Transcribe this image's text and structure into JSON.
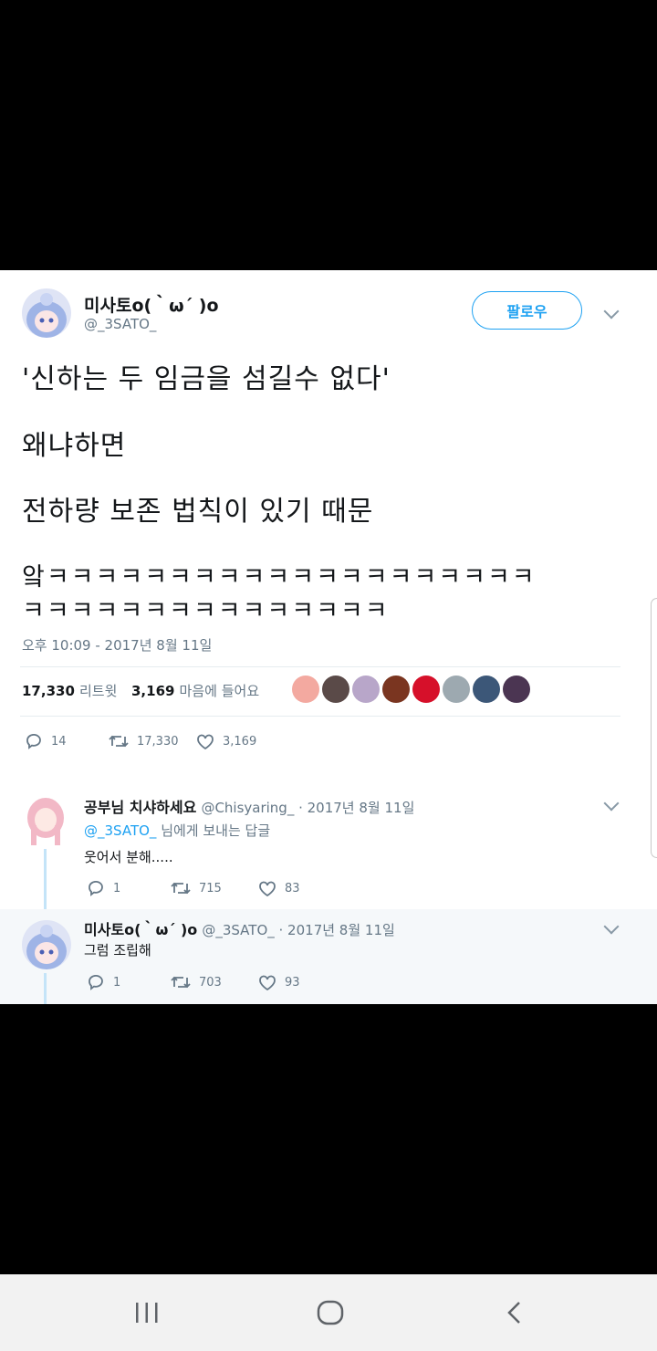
{
  "tweet": {
    "author_name": "미사토o(｀ω´ )o",
    "author_handle": "@_3SATO_",
    "follow_label": "팔로우",
    "lines": [
      "'신하는 두 임금을 섬길수 없다'",
      "왜냐하면",
      "전하량 보존 법칙이 있기 때문",
      "앜ㅋㅋㅋㅋㅋㅋㅋㅋㅋㅋㅋㅋㅋㅋㅋㅋㅋㅋㅋㅋ",
      "ㅋㅋㅋㅋㅋㅋㅋㅋㅋㅋㅋㅋㅋㅋㅋ"
    ],
    "timestamp": "오후 10:09 - 2017년 8월 11일",
    "retweet_count": "17,330",
    "retweet_label": "리트윗",
    "like_count": "3,169",
    "like_label": "마음에 들어요",
    "actions": {
      "replies": "14",
      "retweets": "17,330",
      "likes": "3,169"
    }
  },
  "replies": [
    {
      "name": "공부님 치샤하세요",
      "handle_date": "@Chisyaring_ · 2017년 8월 11일",
      "reply_to_handle": "@_3SATO_",
      "reply_to_suffix": "님에게 보내는 답글",
      "text": "웃어서 분해.....",
      "replies": "1",
      "retweets": "715",
      "likes": "83"
    },
    {
      "name": "미사토o(｀ω´ )o",
      "handle_date": "@_3SATO_ · 2017년 8월 11일",
      "text": "그럼 조립해",
      "replies": "1",
      "retweets": "703",
      "likes": "93"
    }
  ],
  "colors": {
    "accent": "#1da1f2",
    "muted": "#657786",
    "reply_highlight": "#f5f8fa"
  },
  "icons": [
    "reply-icon",
    "retweet-icon",
    "heart-icon",
    "chevron-down-icon",
    "recent-apps-icon",
    "home-icon",
    "back-icon"
  ]
}
